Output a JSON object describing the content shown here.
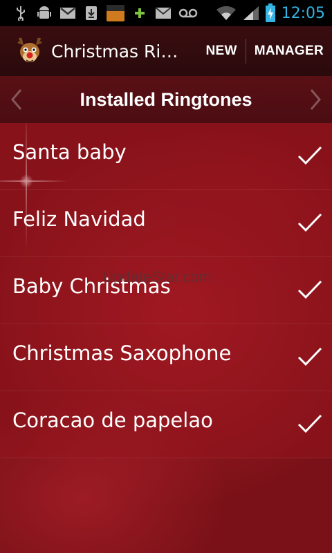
{
  "status_bar": {
    "time": "12:05",
    "icons": [
      "usb-icon",
      "android-debug-icon",
      "gmail-icon",
      "download-icon",
      "amazon-appstore-icon",
      "plus-icon",
      "email-icon",
      "voicemail-icon",
      "wifi-icon",
      "signal-icon",
      "battery-charging-icon"
    ],
    "amazon_label_top": "amazon",
    "amazon_label_bottom": "apps"
  },
  "action_bar": {
    "title": "Christmas Ringtones",
    "new_label": "NEW",
    "manager_label": "MANAGER"
  },
  "section_header": {
    "title": "Installed Ringtones"
  },
  "ringtones": [
    {
      "name": "Santa baby",
      "selected": true
    },
    {
      "name": "Feliz Navidad",
      "selected": true
    },
    {
      "name": "Baby Christmas",
      "selected": true
    },
    {
      "name": "Christmas Saxophone",
      "selected": true
    },
    {
      "name": "Coracao de papelao",
      "selected": true
    }
  ],
  "watermark": "UpdateStar.com",
  "colors": {
    "accent_blue": "#33b5e5",
    "background_red": "#a81d26",
    "action_bar": "#2a0a0c"
  }
}
